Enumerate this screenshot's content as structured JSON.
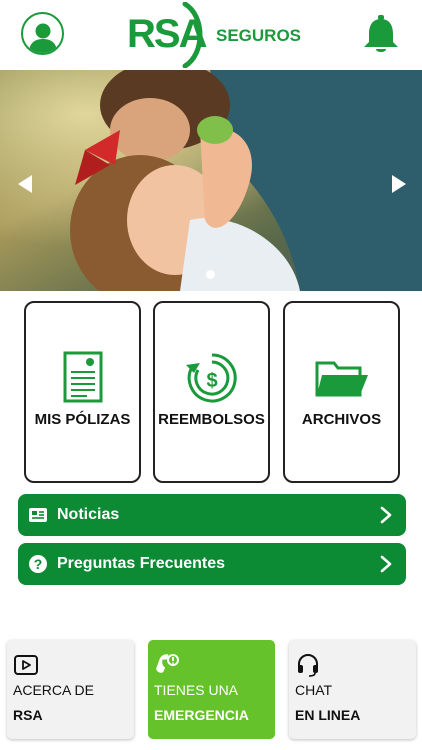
{
  "header": {
    "logo_main": "RSA",
    "logo_sub": "SEGUROS",
    "profile_icon": "user-icon",
    "notification_icon": "bell-icon"
  },
  "carousel": {
    "prev_icon": "triangle-left-icon",
    "next_icon": "triangle-right-icon",
    "slide_count": 1,
    "active_slide": 1
  },
  "tiles": [
    {
      "label": "MIS PÓLIZAS",
      "icon": "document-icon"
    },
    {
      "label": "REEMBOLSOS",
      "icon": "refund-icon"
    },
    {
      "label": "ARCHIVOS",
      "icon": "folder-icon"
    }
  ],
  "links": [
    {
      "label": "Noticias",
      "icon": "newspaper-icon"
    },
    {
      "label": "Preguntas Frecuentes",
      "icon": "question-icon"
    }
  ],
  "bottom_cards": [
    {
      "line1": "ACERCA DE",
      "line2": "RSA",
      "icon": "play-icon"
    },
    {
      "line1": "TIENES UNA",
      "line2": "EMERGENCIA",
      "icon": "phone-icon"
    },
    {
      "line1": "CHAT",
      "line2": "EN LINEA",
      "icon": "headset-icon"
    }
  ],
  "colors": {
    "brand_green": "#1a9a3a",
    "bar_green": "#0d8a34",
    "emergency_green": "#66c22a"
  }
}
